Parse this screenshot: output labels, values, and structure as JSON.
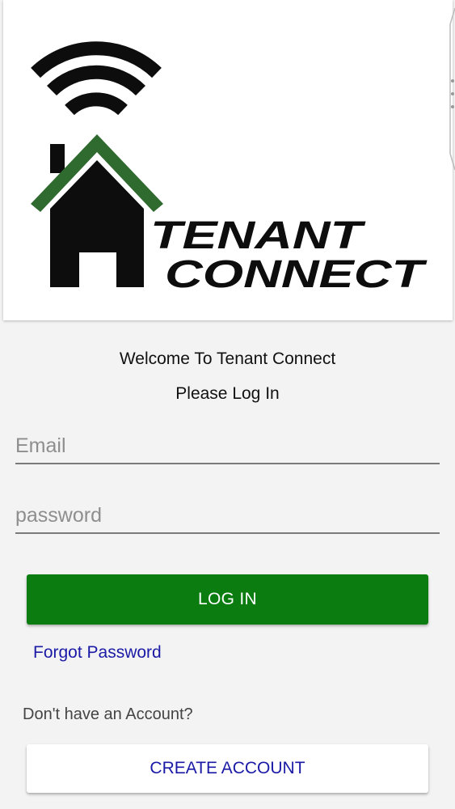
{
  "logo": {
    "line1": "TENANT",
    "line2": "CONNECT",
    "icon": "house-wifi-logo",
    "colors": {
      "roof": "#2f6a2f",
      "house": "#0d0d0d"
    }
  },
  "welcome": {
    "line1": "Welcome To Tenant Connect",
    "line2": "Please Log In"
  },
  "form": {
    "email_placeholder": "Email",
    "password_placeholder": "password"
  },
  "buttons": {
    "login": "LOG IN",
    "forgot": "Forgot Password",
    "no_account": "Don't have an Account?",
    "create": "CREATE ACCOUNT"
  },
  "colors": {
    "primary": "#0b7d10",
    "link": "#1a1aa6",
    "background": "#f3f3f3"
  }
}
